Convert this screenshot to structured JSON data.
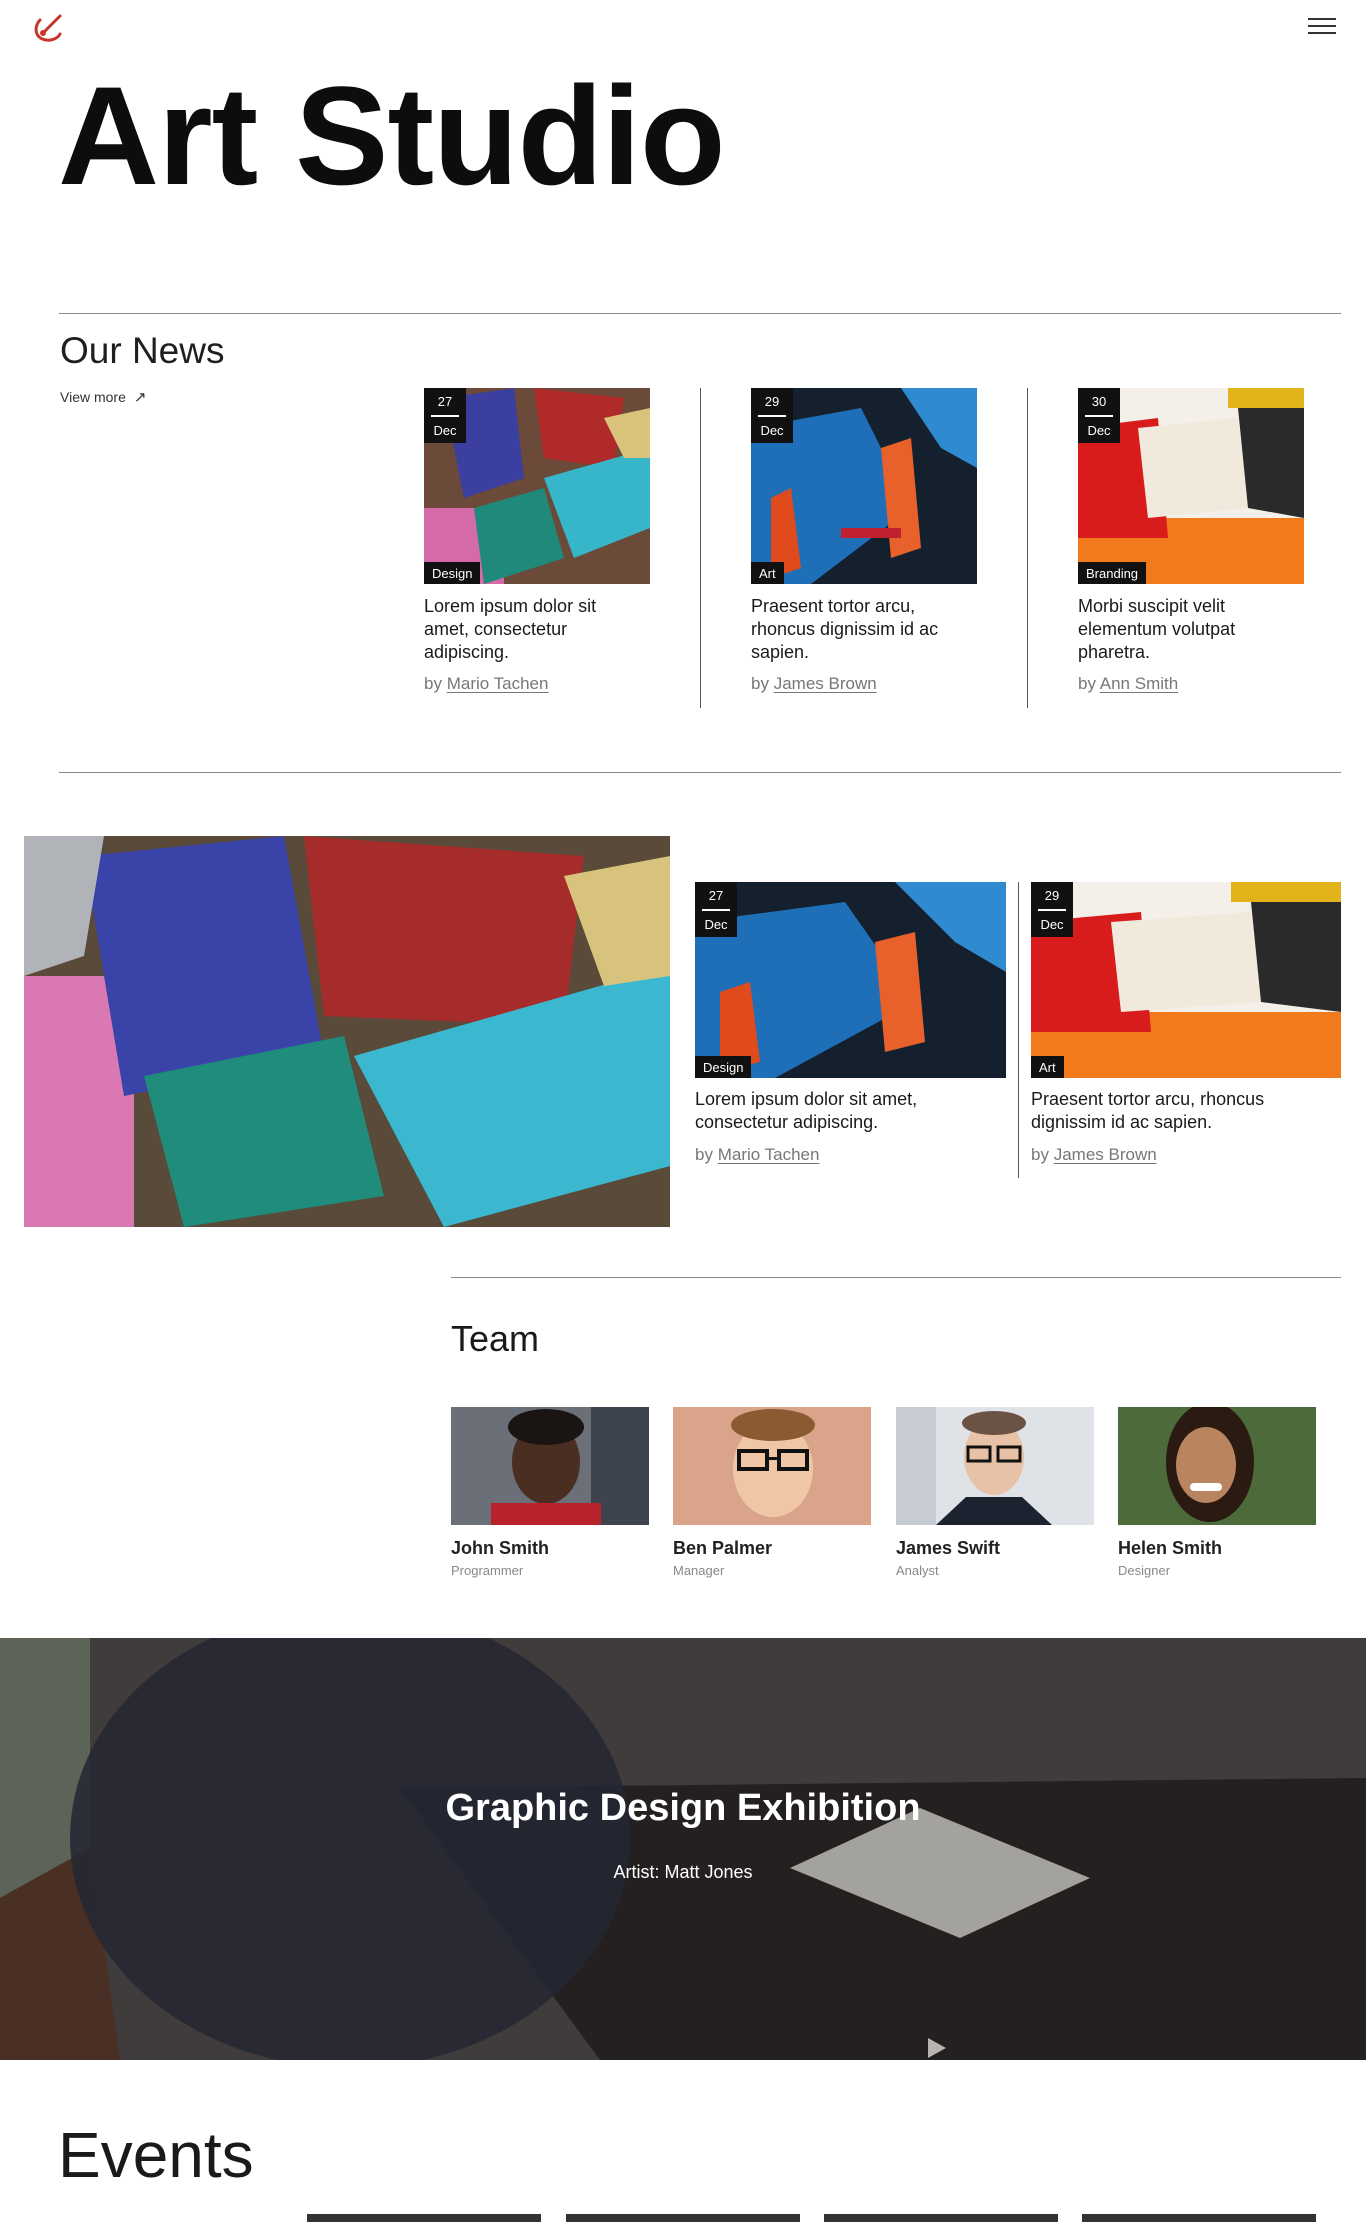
{
  "header": {
    "logo_icon": "brush-stroke-logo-icon",
    "menu_icon": "hamburger-menu-icon",
    "title": "Art Studio"
  },
  "news": {
    "heading": "Our News",
    "view_more": "View more",
    "view_more_icon": "arrow-up-right-icon",
    "items": [
      {
        "day": "27",
        "month": "Dec",
        "category": "Design",
        "text": "Lorem ipsum dolor sit amet, consectetur adipiscing.",
        "by": "by",
        "author": "Mario Tachen"
      },
      {
        "day": "29",
        "month": "Dec",
        "category": "Art",
        "text": "Praesent tortor arcu, rhoncus dignissim id ac sapien.",
        "by": "by",
        "author": "James Brown"
      },
      {
        "day": "30",
        "month": "Dec",
        "category": "Branding",
        "text": "Morbi suscipit velit elementum volutpat pharetra.",
        "by": "by",
        "author": "Ann Smith"
      }
    ]
  },
  "featured": {
    "items": [
      {
        "day": "27",
        "month": "Dec",
        "category": "Design",
        "text": "Lorem ipsum dolor sit amet, consectetur adipiscing.",
        "by": "by",
        "author": "Mario Tachen"
      },
      {
        "day": "29",
        "month": "Dec",
        "category": "Art",
        "text": "Praesent tortor arcu, rhoncus dignissim id ac sapien.",
        "by": "by",
        "author": "James Brown"
      }
    ]
  },
  "team": {
    "heading": "Team",
    "members": [
      {
        "name": "John Smith",
        "role": "Programmer"
      },
      {
        "name": "Ben Palmer",
        "role": "Manager"
      },
      {
        "name": "James Swift",
        "role": "Analyst"
      },
      {
        "name": "Helen Smith",
        "role": "Designer"
      }
    ]
  },
  "exhibition": {
    "title": "Graphic Design Exhibition",
    "subtitle": "Artist: Matt Jones",
    "play_icon": "play-icon"
  },
  "events": {
    "heading": "Events"
  },
  "colors": {
    "logo_accent": "#c8362a",
    "badge_bg": "#111111",
    "rule": "#8a8a8a"
  }
}
